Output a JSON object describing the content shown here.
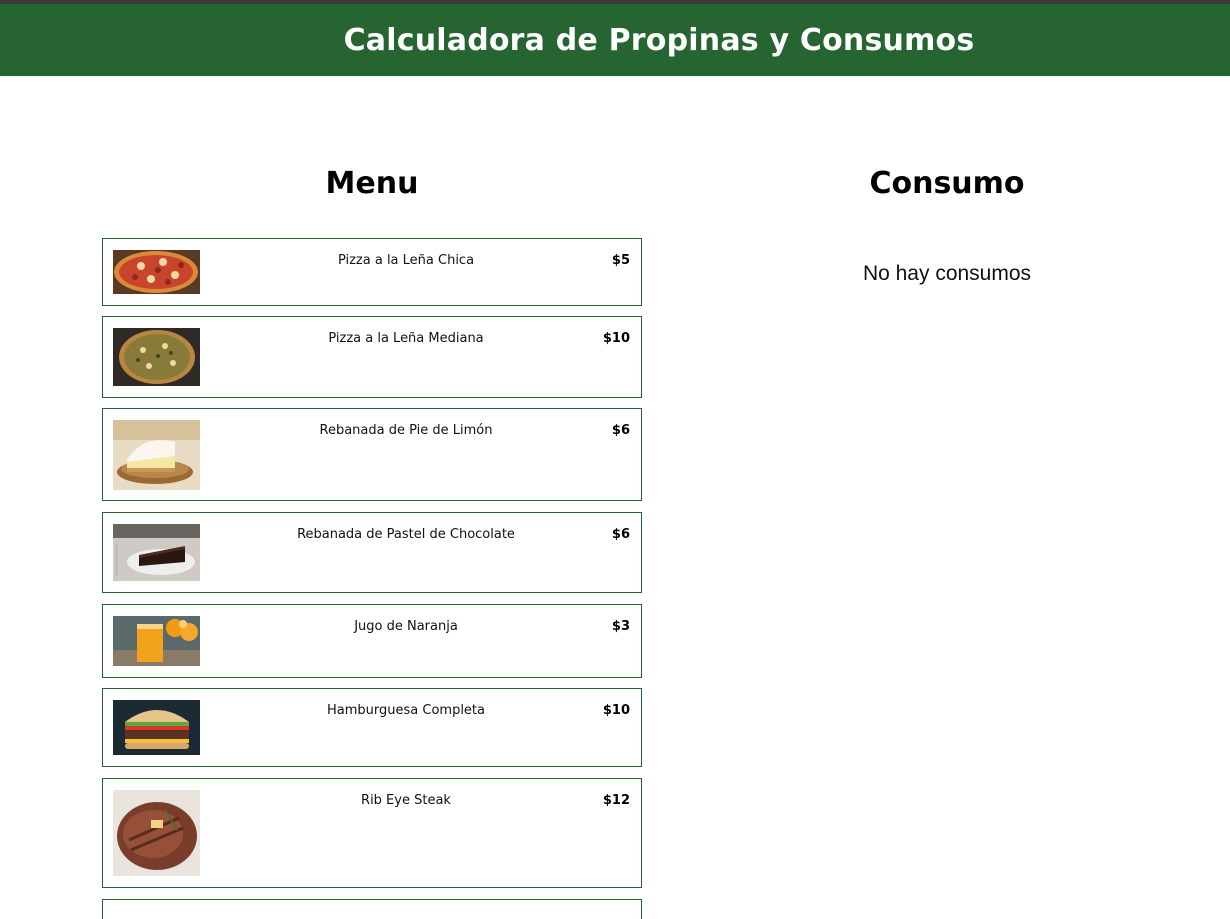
{
  "header": {
    "title": "Calculadora de Propinas y Consumos"
  },
  "menu": {
    "title": "Menu",
    "items": [
      {
        "name": "Pizza a la Leña Chica",
        "price": "$5",
        "image": "pizza-small-image"
      },
      {
        "name": "Pizza a la Leña Mediana",
        "price": "$10",
        "image": "pizza-medium-image"
      },
      {
        "name": "Rebanada de Pie de Limón",
        "price": "$6",
        "image": "lemon-pie-image"
      },
      {
        "name": "Rebanada de Pastel de Chocolate",
        "price": "$6",
        "image": "chocolate-cake-image"
      },
      {
        "name": "Jugo de Naranja",
        "price": "$3",
        "image": "orange-juice-image"
      },
      {
        "name": "Hamburguesa Completa",
        "price": "$10",
        "image": "burger-image"
      },
      {
        "name": "Rib Eye Steak",
        "price": "$12",
        "image": "steak-image"
      }
    ]
  },
  "consumo": {
    "title": "Consumo",
    "empty_message": "No hay consumos"
  },
  "colors": {
    "header_bg": "#266532",
    "item_border": "#266532",
    "header_text": "#ffffff"
  }
}
